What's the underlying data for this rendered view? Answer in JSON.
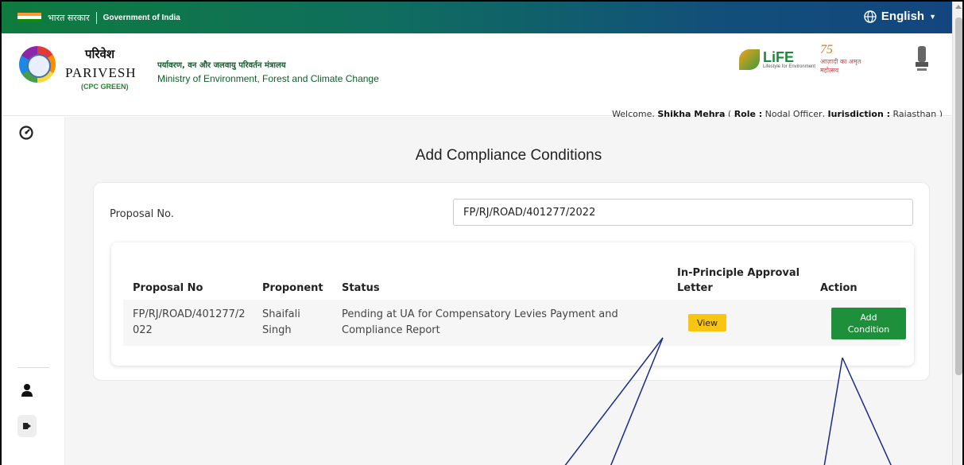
{
  "gov_bar": {
    "hindi": "भारत सरकार",
    "english": "Government of India",
    "language": "English"
  },
  "header": {
    "brand_hindi": "परिवेश",
    "brand_english": "PARIVESH",
    "brand_sub": "(CPC GREEN)",
    "ministry_hindi": "पर्यावरण, वन और जलवायु परिवर्तन मंत्रालय",
    "ministry_english": "Ministry of Environment, Forest and Climate Change",
    "life_text": "LiFE",
    "life_sub": "Lifestyle for Environment",
    "azadi_75": "75",
    "azadi_text": "आज़ादी का अमृत महोत्सव"
  },
  "welcome": {
    "prefix": "Welcome, ",
    "user": "Shikha Mehra",
    "open": " ( ",
    "role_label": "Role :",
    "role": " Nodal Officer, ",
    "jur_label": "Jurisdiction :",
    "jurisdiction": " Rajasthan",
    "close": " )"
  },
  "page": {
    "title": "Add Compliance Conditions",
    "proposal_label": "Proposal No.",
    "proposal_value": "FP/RJ/ROAD/401277/2022"
  },
  "table": {
    "headers": {
      "proposal_no": "Proposal No",
      "proponent": "Proponent",
      "status": "Status",
      "letter_line1": "In-Principle Approval",
      "letter_line2": "Letter",
      "action": "Action"
    },
    "rows": [
      {
        "proposal_line1": "FP/RJ/ROAD/401277/2",
        "proposal_line2": "022",
        "proponent_line1": "Shaifali",
        "proponent_line2": "Singh",
        "status_line1": "Pending at UA for Compensatory Levies Payment and",
        "status_line2": "Compliance Report",
        "view_label": "View",
        "add_line1": "Add",
        "add_line2": "Condition"
      }
    ]
  },
  "colors": {
    "primary_green": "#1e8f3a",
    "view_yellow": "#f9c513",
    "arrow_blue": "#1a2a8a"
  },
  "icons": {
    "dashboard": "dashboard-icon",
    "user": "user-icon",
    "logout": "logout-icon",
    "globe": "globe-icon"
  }
}
